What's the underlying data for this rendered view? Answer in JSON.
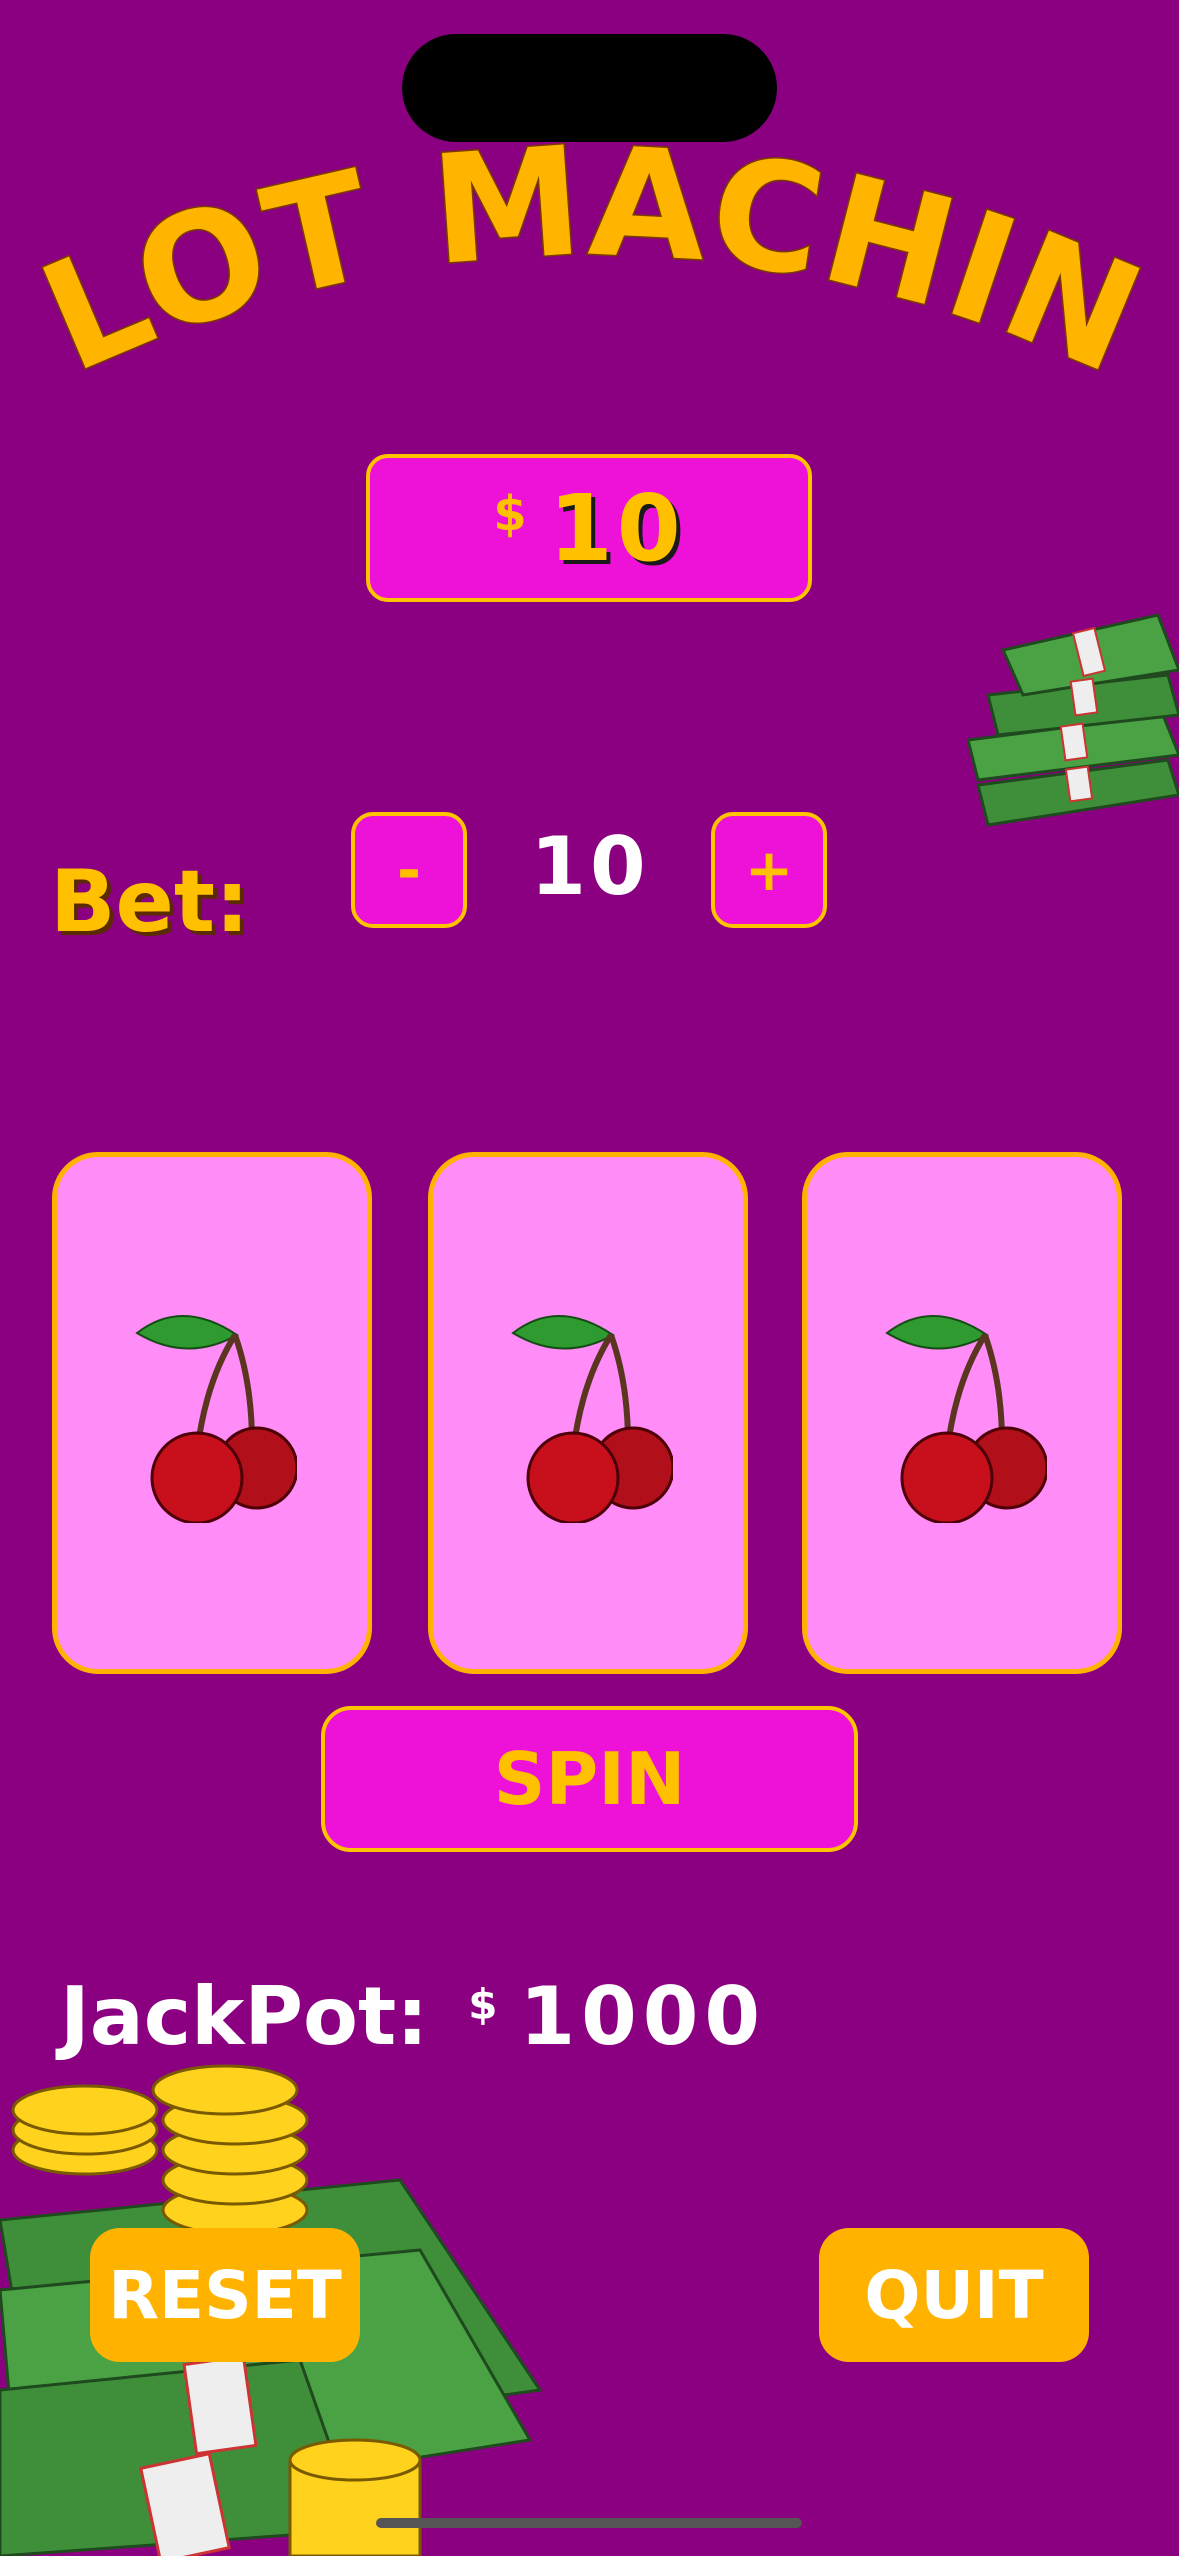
{
  "app": {
    "title": "SLOT MACHINE"
  },
  "balance": {
    "currency_symbol": "$",
    "amount": "10"
  },
  "bet": {
    "label": "Bet:",
    "value": "10",
    "decrement_label": "-",
    "increment_label": "+"
  },
  "reels": [
    {
      "symbol": "cherry-icon"
    },
    {
      "symbol": "cherry-icon"
    },
    {
      "symbol": "cherry-icon"
    }
  ],
  "spin": {
    "label": "SPIN"
  },
  "jackpot": {
    "label": "JackPot:",
    "currency_symbol": "$",
    "amount": "1000"
  },
  "actions": {
    "reset_label": "RESET",
    "quit_label": "QUIT"
  },
  "colors": {
    "background": "#8B0080",
    "accent_magenta": "#EE12D8",
    "accent_gold": "#FFC000",
    "reel_fill": "#FF8CF7",
    "button_gold": "#FFB300"
  }
}
